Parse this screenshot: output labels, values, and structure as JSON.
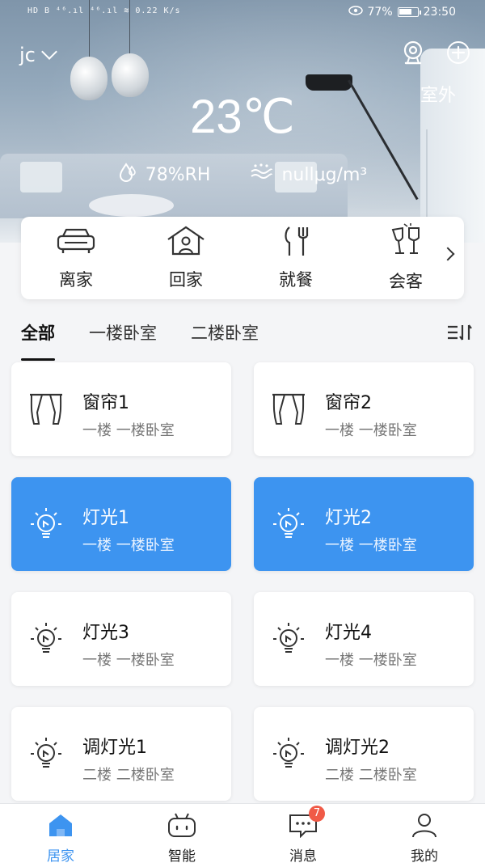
{
  "status_bar": {
    "left_text": "HD B ⁴⁶.ıl ⁴⁶.ıl ≋ 0.22 K/s",
    "battery_percent": "77%",
    "battery_level": 0.77,
    "time": "23:50"
  },
  "header": {
    "home_name": "jc",
    "outdoor_label": "室外",
    "temperature": "23℃",
    "humidity": "78%RH",
    "air_quality": "nullμg/m³"
  },
  "scenes": [
    {
      "label": "离家",
      "icon": "car-icon"
    },
    {
      "label": "回家",
      "icon": "home-person-icon"
    },
    {
      "label": "就餐",
      "icon": "cutlery-icon"
    },
    {
      "label": "会客",
      "icon": "wine-glasses-icon"
    }
  ],
  "tabs": [
    {
      "label": "全部",
      "active": true
    },
    {
      "label": "一楼卧室",
      "active": false
    },
    {
      "label": "二楼卧室",
      "active": false
    }
  ],
  "devices": [
    {
      "name": "窗帘1",
      "room": "一楼 一楼卧室",
      "type": "curtain",
      "on": false
    },
    {
      "name": "窗帘2",
      "room": "一楼 一楼卧室",
      "type": "curtain",
      "on": false
    },
    {
      "name": "灯光1",
      "room": "一楼 一楼卧室",
      "type": "light",
      "on": true
    },
    {
      "name": "灯光2",
      "room": "一楼 一楼卧室",
      "type": "light",
      "on": true
    },
    {
      "name": "灯光3",
      "room": "一楼 一楼卧室",
      "type": "light",
      "on": false
    },
    {
      "name": "灯光4",
      "room": "一楼 一楼卧室",
      "type": "light",
      "on": false
    },
    {
      "name": "调灯光1",
      "room": "二楼 二楼卧室",
      "type": "light",
      "on": false
    },
    {
      "name": "调灯光2",
      "room": "二楼 二楼卧室",
      "type": "light",
      "on": false
    }
  ],
  "nav": [
    {
      "label": "居家",
      "icon": "home-icon",
      "active": true
    },
    {
      "label": "智能",
      "icon": "robot-icon",
      "active": false
    },
    {
      "label": "消息",
      "icon": "message-icon",
      "active": false,
      "badge": "7"
    },
    {
      "label": "我的",
      "icon": "user-icon",
      "active": false
    }
  ],
  "colors": {
    "accent": "#3d94f0",
    "badge": "#f05a47"
  }
}
